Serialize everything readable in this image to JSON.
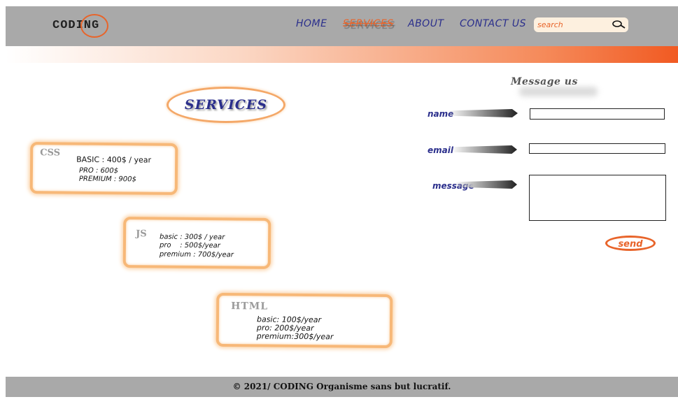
{
  "header": {
    "logo_text": "CODING",
    "nav": [
      {
        "label": "HOME"
      },
      {
        "label": "SERVICES"
      },
      {
        "label": "ABOUT"
      },
      {
        "label": "CONTACT US"
      }
    ],
    "search": {
      "placeholder": "search"
    }
  },
  "services": {
    "title": "SERVICES",
    "cards": [
      {
        "tag": "CSS",
        "lines": [
          "BASIC : 400$ / year",
          "PRO : 600$",
          "PREMIUM : 900$"
        ]
      },
      {
        "tag": "JS",
        "lines": [
          "basic : 300$ / year",
          "pro    : 500$/year",
          "premium : 700$/year"
        ]
      },
      {
        "tag": "HTML",
        "lines": [
          "basic: 100$/year",
          "pro: 200$/year",
          "premium:300$/year"
        ]
      }
    ]
  },
  "contact": {
    "title": "Message us",
    "name_label": "name",
    "email_label": "email",
    "message_label": "message",
    "send_label": "send"
  },
  "footer": {
    "text": "© 2021/ CODING Organisme sans but lucratif."
  },
  "colors": {
    "header_bg": "#a9a9a9",
    "accent_orange": "#e8642a",
    "nav_blue": "#2b2f8c",
    "card_border": "#f7b878"
  },
  "icons": {
    "search": "magnifier-icon",
    "brush": "brush-stroke-icon"
  }
}
